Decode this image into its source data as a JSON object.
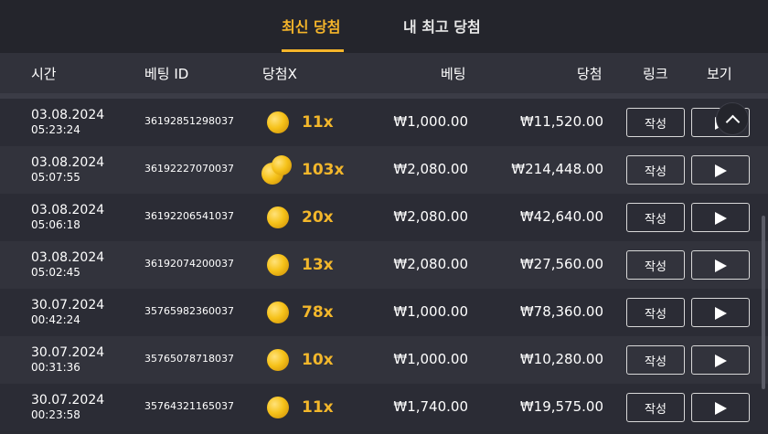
{
  "tabs": {
    "latest": "최신 당첨",
    "best": "내 최고 당첨"
  },
  "columns": {
    "time": "시간",
    "bet_id": "베팅 ID",
    "multiplier": "당첨X",
    "bet": "베팅",
    "win": "당첨",
    "link": "링크",
    "view": "보기"
  },
  "rows": [
    {
      "date": "03.08.2024",
      "time": "05:23:24",
      "bet_id": "36192851298037",
      "coins": 1,
      "multiplier": "11x",
      "bet": "₩1,000.00",
      "win": "₩11,520.00",
      "write_label": "작성"
    },
    {
      "date": "03.08.2024",
      "time": "05:07:55",
      "bet_id": "36192227070037",
      "coins": 2,
      "multiplier": "103x",
      "bet": "₩2,080.00",
      "win": "₩214,448.00",
      "write_label": "작성"
    },
    {
      "date": "03.08.2024",
      "time": "05:06:18",
      "bet_id": "36192206541037",
      "coins": 1,
      "multiplier": "20x",
      "bet": "₩2,080.00",
      "win": "₩42,640.00",
      "write_label": "작성"
    },
    {
      "date": "03.08.2024",
      "time": "05:02:45",
      "bet_id": "36192074200037",
      "coins": 1,
      "multiplier": "13x",
      "bet": "₩2,080.00",
      "win": "₩27,560.00",
      "write_label": "작성"
    },
    {
      "date": "30.07.2024",
      "time": "00:42:24",
      "bet_id": "35765982360037",
      "coins": 1,
      "multiplier": "78x",
      "bet": "₩1,000.00",
      "win": "₩78,360.00",
      "write_label": "작성"
    },
    {
      "date": "30.07.2024",
      "time": "00:31:36",
      "bet_id": "35765078718037",
      "coins": 1,
      "multiplier": "10x",
      "bet": "₩1,000.00",
      "win": "₩10,280.00",
      "write_label": "작성"
    },
    {
      "date": "30.07.2024",
      "time": "00:23:58",
      "bet_id": "35764321165037",
      "coins": 1,
      "multiplier": "11x",
      "bet": "₩1,740.00",
      "win": "₩19,575.00",
      "write_label": "작성"
    }
  ],
  "icons": {
    "coin": "gold-coin-icon",
    "play": "play-icon",
    "scroll_top": "chevron-up-icon"
  },
  "colors": {
    "accent": "#f5b52a",
    "multiplier": "#f3b72b",
    "background": "#2a2b33"
  }
}
